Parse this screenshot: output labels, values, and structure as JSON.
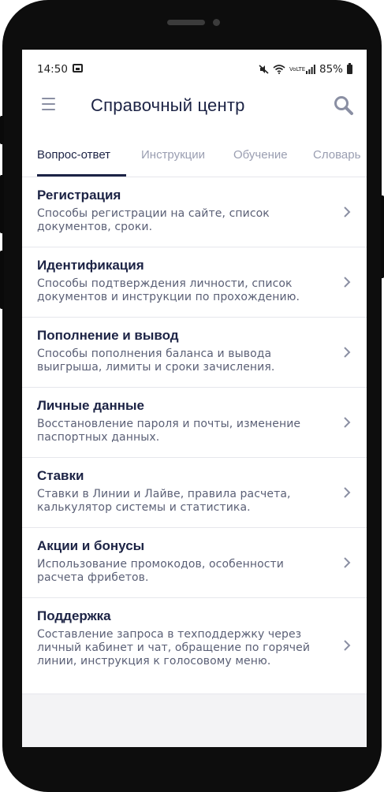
{
  "status_bar": {
    "time": "14:50",
    "icons": [
      "image-icon",
      "mute-icon",
      "wifi-icon",
      "volte-icon",
      "signal-icon"
    ],
    "network": "VoLTE",
    "battery": "85%"
  },
  "app_bar": {
    "title": "Справочный центр",
    "menu_icon": "hamburger-menu-icon",
    "search_icon": "search-icon"
  },
  "tabs": [
    {
      "label": "Вопрос-ответ",
      "active": true
    },
    {
      "label": "Инструкции",
      "active": false
    },
    {
      "label": "Обучение",
      "active": false
    },
    {
      "label": "Словарь",
      "active": false
    }
  ],
  "items": [
    {
      "title": "Регистрация",
      "description": "Способы регистрации на сайте, список документов, сроки."
    },
    {
      "title": "Идентификация",
      "description": "Способы подтверждения личности, список документов и инструкции по прохождению."
    },
    {
      "title": "Пополнение и вывод",
      "description": "Способы пополнения баланса и вывода выигрыша, лимиты и сроки зачисления."
    },
    {
      "title": "Личные данные",
      "description": "Восстановление пароля и почты, изменение паспортных данных."
    },
    {
      "title": "Ставки",
      "description": "Ставки в Линии и Лайве, правила расчета, калькулятор системы и статистика."
    },
    {
      "title": "Акции и бонусы",
      "description": "Использование промокодов, особенности расчета фрибетов."
    },
    {
      "title": "Поддержка",
      "description": "Составление запроса в техподдержку через личный кабинет и чат, обращение по горячей линии, инструкция к голосовому меню."
    }
  ],
  "colors": {
    "title_text": "#1c2345",
    "body_text": "#5b6076",
    "inactive_tab": "#9a9eb1",
    "background": "#f3f3f5"
  }
}
